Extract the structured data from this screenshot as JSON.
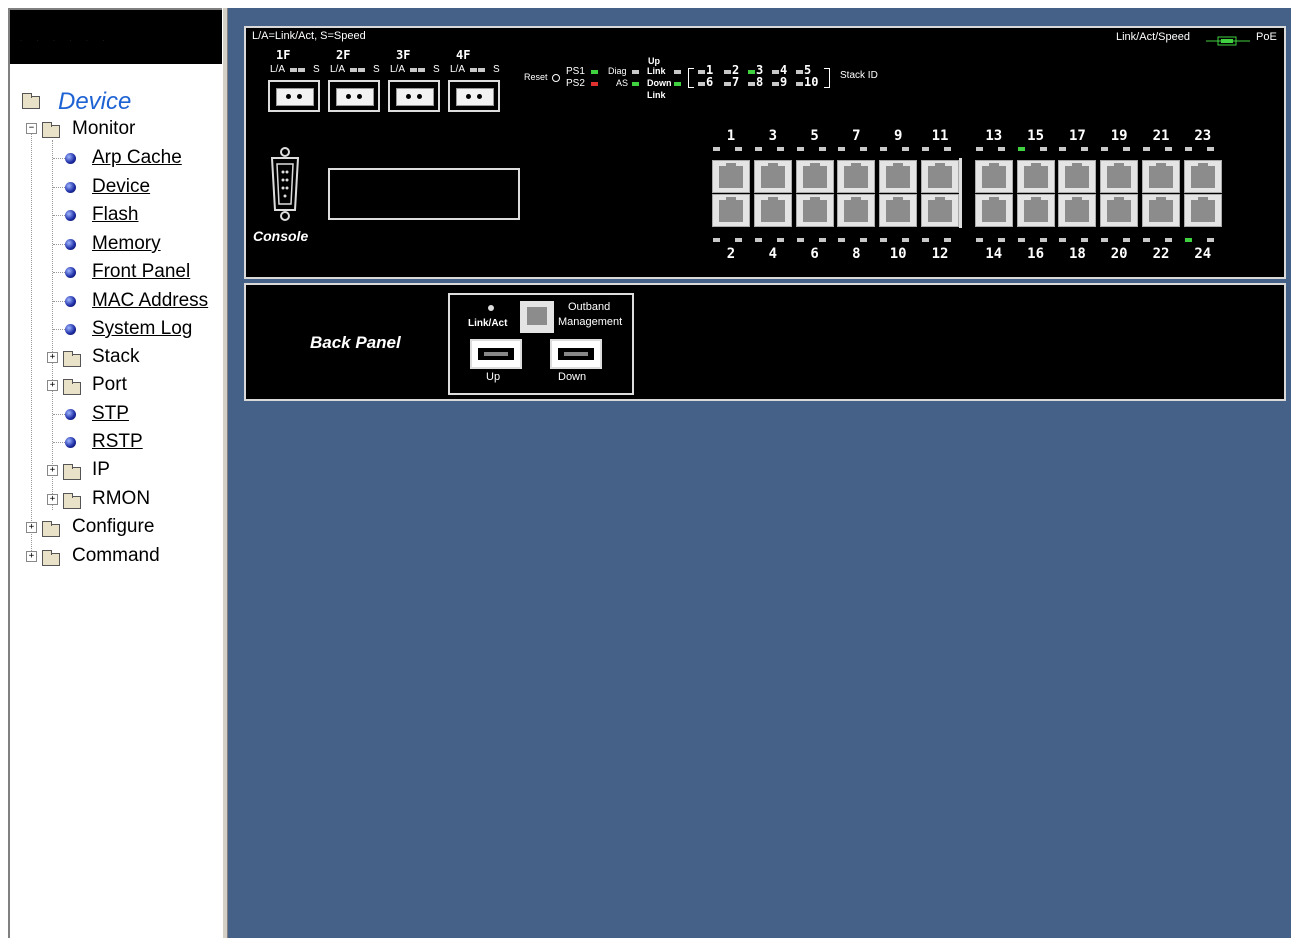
{
  "sidebar": {
    "top_dots": ". . . . . .",
    "title": "Device",
    "items": [
      {
        "label": "Monitor"
      },
      {
        "label": "Arp Cache"
      },
      {
        "label": "Device"
      },
      {
        "label": "Flash"
      },
      {
        "label": "Memory"
      },
      {
        "label": "Front Panel"
      },
      {
        "label": "MAC Address"
      },
      {
        "label": "System Log"
      },
      {
        "label": "Stack"
      },
      {
        "label": "Port"
      },
      {
        "label": "STP"
      },
      {
        "label": "RSTP"
      },
      {
        "label": "IP"
      },
      {
        "label": "RMON"
      },
      {
        "label": "Configure"
      },
      {
        "label": "Command"
      }
    ]
  },
  "front_panel": {
    "legend_left": "L/A=Link/Act, S=Speed",
    "legend_right": "Link/Act/Speed",
    "legend_poe": "PoE",
    "sfp_labels": [
      "1F",
      "2F",
      "3F",
      "4F"
    ],
    "sfp_sub": "L/A",
    "sfp_s": "S",
    "reset": "Reset",
    "ps1": "PS1",
    "ps2": "PS2",
    "diag": "Diag",
    "as": "AS",
    "up": "Up",
    "link": "Link",
    "down": "Down",
    "link2": "Link",
    "stack_nums_top": [
      "1",
      "2",
      "3",
      "4",
      "5"
    ],
    "stack_nums_bottom": [
      "6",
      "7",
      "8",
      "9",
      "10"
    ],
    "stack_id": "Stack ID",
    "console": "Console",
    "ports_top": [
      "1",
      "3",
      "5",
      "7",
      "9",
      "11",
      "13",
      "15",
      "17",
      "19",
      "21",
      "23"
    ],
    "ports_bottom": [
      "2",
      "4",
      "6",
      "8",
      "10",
      "12",
      "14",
      "16",
      "18",
      "20",
      "22",
      "24"
    ]
  },
  "back_panel": {
    "label": "Back Panel",
    "link_act": "Link/Act",
    "outband": "Outband",
    "management": "Management",
    "up": "Up",
    "down": "Down"
  },
  "colors": {
    "background": "#456187",
    "led_green": "#3fd13f",
    "led_red": "#e03030",
    "title_blue": "#1e63d4"
  }
}
